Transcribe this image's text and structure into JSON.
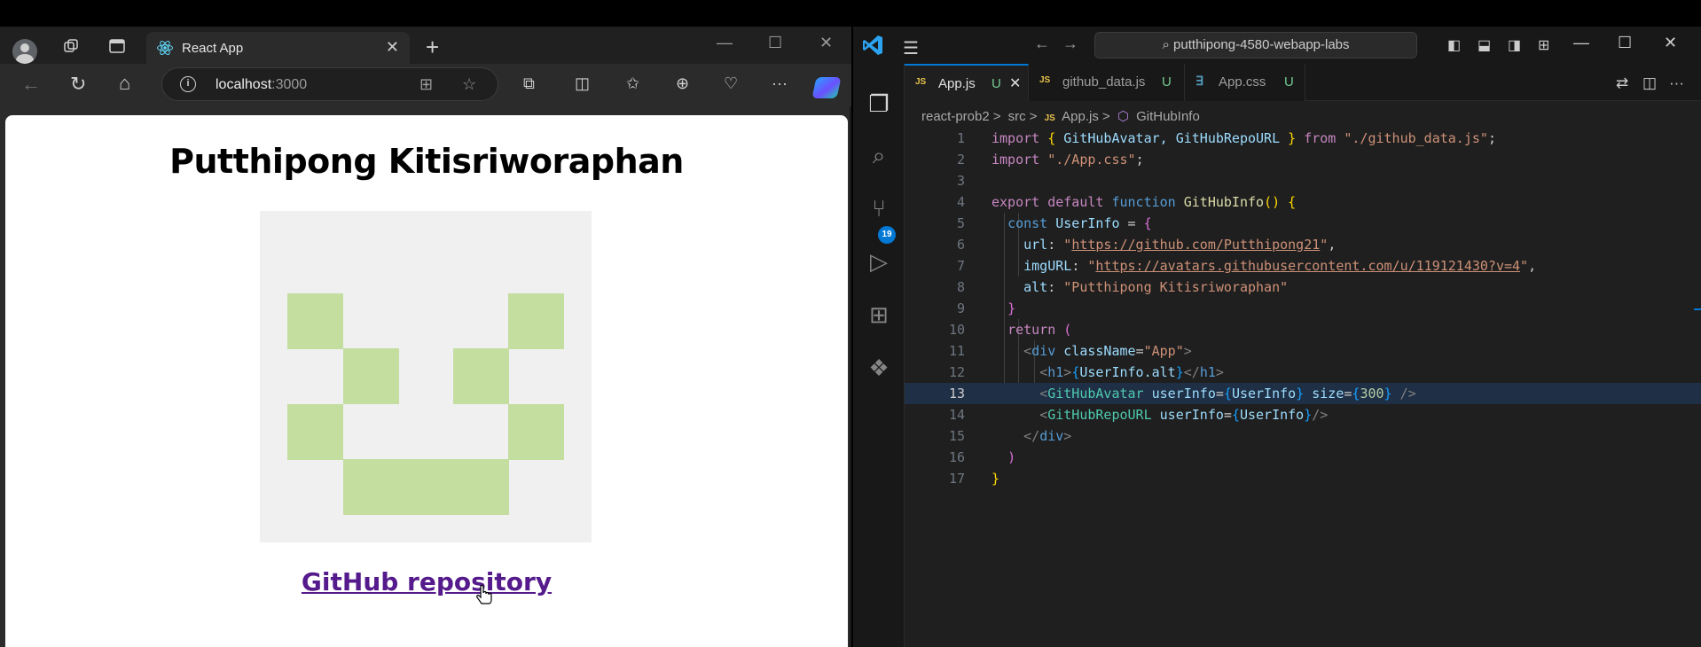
{
  "browser": {
    "tab_title": "React App",
    "url_host": "localhost",
    "url_port": ":3000",
    "page": {
      "heading": "Putthipong Kitisriworaphan",
      "repo_link": "GitHub repository"
    },
    "icons": [
      "profile-icon",
      "workspaces-icon",
      "tab-actions-icon",
      "react-icon",
      "close-icon",
      "new-tab-icon",
      "back-icon",
      "refresh-icon",
      "home-icon",
      "info-icon",
      "apps-icon",
      "favorite-star-icon",
      "extensions-icon",
      "split-screen-icon",
      "favorites-icon",
      "collections-icon",
      "browser-essentials-icon",
      "more-icon",
      "copilot-icon"
    ]
  },
  "vscode": {
    "search_text": "putthipong-4580-webapp-labs",
    "tabs": [
      {
        "type": "JS",
        "name": "App.js",
        "status": "U",
        "active": true
      },
      {
        "type": "JS",
        "name": "github_data.js",
        "status": "U",
        "active": false
      },
      {
        "type": "CSS",
        "name": "App.css",
        "status": "U",
        "active": false
      }
    ],
    "breadcrumb": [
      "react-prob2",
      "src",
      "App.js",
      "GitHubInfo"
    ],
    "scm_badge": "19",
    "line_numbers": [
      "1",
      "2",
      "3",
      "4",
      "5",
      "6",
      "7",
      "8",
      "9",
      "10",
      "11",
      "12",
      "13",
      "14",
      "15",
      "16",
      "17"
    ],
    "code": {
      "l1_import": "import",
      "l1_names": "GitHubAvatar, GitHubRepoURL",
      "l1_from": "from",
      "l1_path": "\"./github_data.js\"",
      "l2_path": "\"./App.css\"",
      "l4_fn": "GitHubInfo",
      "l5_const": "UserInfo",
      "l6_url": "https://github.com/Putthipong21",
      "l7_img": "https://avatars.githubusercontent.com/u/119121430?v=4",
      "l8_alt": "\"Putthipong Kitisriworaphan\"",
      "l11_class": "\"App\"",
      "l13_size": "300"
    }
  },
  "colors": {
    "avatar_bg": "#f0f0f0",
    "avatar_fg": "#c3de9f",
    "link_visited": "#551a8b",
    "vscode_accent": "#0078d4"
  }
}
